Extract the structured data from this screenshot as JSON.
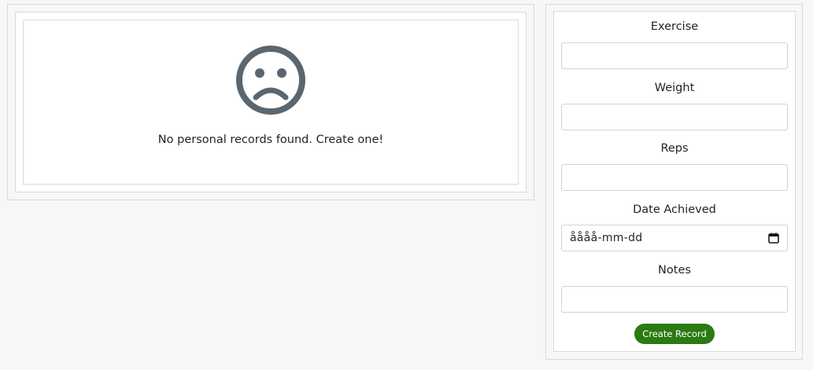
{
  "empty_state": {
    "icon": "sad-face-icon",
    "message": "No personal records found. Create one!"
  },
  "form": {
    "fields": [
      {
        "label": "Exercise",
        "value": ""
      },
      {
        "label": "Weight",
        "value": ""
      },
      {
        "label": "Reps",
        "value": ""
      },
      {
        "label": "Date Achieved",
        "value": "",
        "placeholder": "åååå-mm-dd"
      },
      {
        "label": "Notes",
        "value": ""
      }
    ],
    "submit_label": "Create Record"
  },
  "colors": {
    "button": "#2c7a12",
    "icon": "#5a6670",
    "background": "#f7f7f7"
  }
}
